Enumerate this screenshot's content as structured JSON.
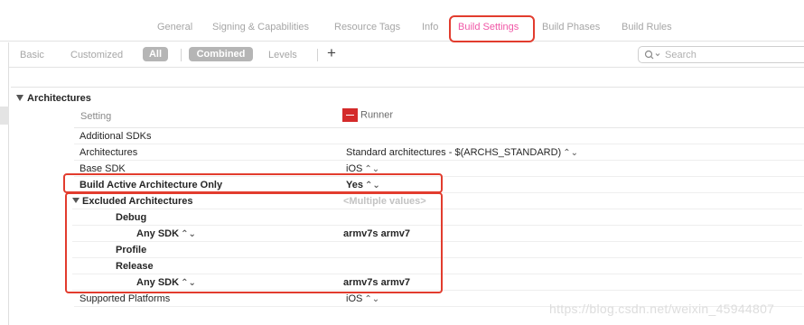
{
  "tabs": [
    {
      "label": "General",
      "active": false
    },
    {
      "label": "Signing & Capabilities",
      "active": false
    },
    {
      "label": "Resource Tags",
      "active": false
    },
    {
      "label": "Info",
      "active": false
    },
    {
      "label": "Build Settings",
      "active": true
    },
    {
      "label": "Build Phases",
      "active": false
    },
    {
      "label": "Build Rules",
      "active": false
    }
  ],
  "filters": {
    "basic": "Basic",
    "customized": "Customized",
    "all": "All",
    "combined": "Combined",
    "levels": "Levels",
    "add": "+"
  },
  "search": {
    "placeholder": "Search"
  },
  "section": {
    "title": "Architectures"
  },
  "header": {
    "setting": "Setting",
    "target": "Runner"
  },
  "rows": {
    "additional_sdks": {
      "label": "Additional SDKs",
      "value": ""
    },
    "architectures": {
      "label": "Architectures",
      "value": "Standard architectures  -  $(ARCHS_STANDARD)",
      "stepper": "⌃⌄"
    },
    "base_sdk": {
      "label": "Base SDK",
      "value": "iOS",
      "stepper": "⌃⌄"
    },
    "build_active_arch": {
      "label": "Build Active Architecture Only",
      "value": "Yes",
      "stepper": "⌃⌄"
    },
    "excluded_arch": {
      "label": "Excluded Architectures",
      "value": "<Multiple values>"
    },
    "debug": {
      "label": "Debug"
    },
    "debug_any_sdk": {
      "label": "Any SDK",
      "stepper": "⌃⌄",
      "value": "armv7s armv7"
    },
    "profile": {
      "label": "Profile"
    },
    "release": {
      "label": "Release"
    },
    "release_any_sdk": {
      "label": "Any SDK",
      "stepper": "⌃⌄",
      "value": "armv7s armv7"
    },
    "supported_platforms": {
      "label": "Supported Platforms",
      "value": "iOS",
      "stepper": "⌃⌄"
    }
  },
  "watermark": "https://blog.csdn.net/weixin_45944807",
  "colors": {
    "accent_pink": "#f056a6",
    "highlight_red": "#e23c2e",
    "target_icon": "#d42a2a"
  }
}
